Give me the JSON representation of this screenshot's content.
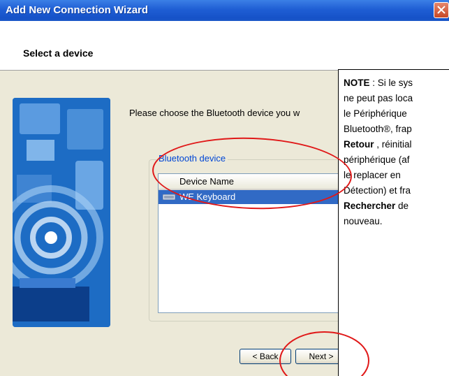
{
  "window": {
    "title": "Add New Connection Wizard"
  },
  "header": {
    "title": "Select a device"
  },
  "content": {
    "prompt": "Please choose the Bluetooth device you w",
    "group_label": "Bluetooth device",
    "list": {
      "column_header": "Device Name",
      "rows": [
        {
          "label": "WE Keyboard",
          "icon": "keyboard-icon",
          "selected": true
        }
      ]
    }
  },
  "buttons": {
    "back_label": "< Back",
    "next_label": "Next >"
  },
  "note": {
    "label": "NOTE",
    "text1": " : Si le sys",
    "text2": "ne peut pas loca",
    "text3": "le Périphérique",
    "text4": "Bluetooth®, frap",
    "retour": "Retour",
    "text5": " , réinitial",
    "text6": "périphérique (af",
    "text7": "le replacer en",
    "text8": "Détection) et fra",
    "rechercher": "Rechercher",
    "text9": " de",
    "text10": "nouveau."
  },
  "colors": {
    "titlebar": "#1f5ed4",
    "selection": "#316ac5",
    "annotation": "#e01818",
    "link_label": "#0046d5"
  }
}
